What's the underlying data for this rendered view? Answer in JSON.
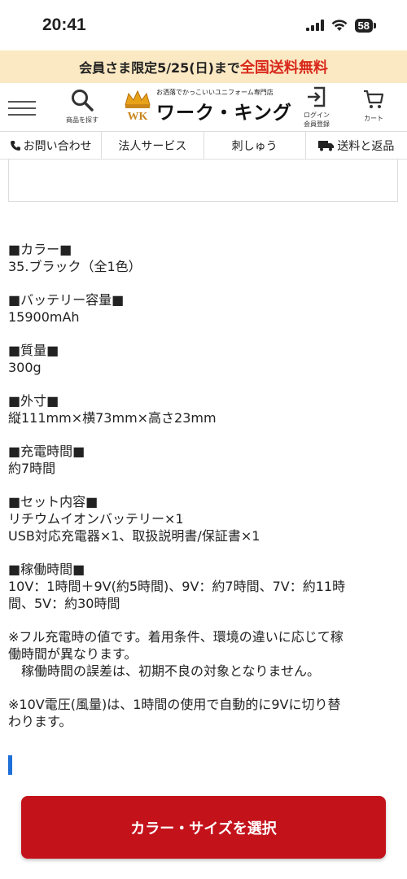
{
  "status_bar": {
    "time": "20:41",
    "battery": "58"
  },
  "promo": {
    "text": "会員さま限定5/25(日)まで",
    "highlight": "全国送料無料"
  },
  "header": {
    "search_label": "商品を探す",
    "logo_tagline": "お洒落でかっこいいユニフォーム専門店",
    "logo_name": "ワーク・キング",
    "logo_mark": "WK",
    "login_label_1": "ログイン",
    "login_label_2": "会員登録",
    "cart_label": "カート"
  },
  "nav": {
    "items": [
      {
        "label": "お問い合わせ",
        "icon": "phone-icon"
      },
      {
        "label": "法人サービス"
      },
      {
        "label": "刺しゅう"
      },
      {
        "label": "送料と返品",
        "icon": "truck-icon"
      }
    ]
  },
  "specs": [
    {
      "heading": "■カラー■",
      "value": "35.ブラック（全1色）"
    },
    {
      "heading": "■バッテリー容量■",
      "value": "15900mAh"
    },
    {
      "heading": "■質量■",
      "value": "300g"
    },
    {
      "heading": "■外寸■",
      "value": "縦111mm×横73mm×高さ23mm"
    },
    {
      "heading": "■充電時間■",
      "value": "約7時間"
    },
    {
      "heading": "■セット内容■",
      "value": "リチウムイオンバッテリー×1\nUSB対応充電器×1、取扱説明書/保証書×1"
    },
    {
      "heading": "■稼働時間■",
      "value": "10V：1時間＋9V(約5時間)、9V：約7時間、7V：約11時\n間、5V：約30時間"
    }
  ],
  "notes": [
    "※フル充電時の値です。着用条件、環境の違いに応じて稼\n働時間が異なります。\n　稼働時間の誤差は、初期不良の対象となりません。",
    "※10V電圧(風量)は、1時間の使用で自動的に9Vに切り替\nわります。"
  ],
  "cta": {
    "label": "カラー・サイズを選択"
  },
  "colors": {
    "promo_bg": "#fbe9c3",
    "accent_red": "#d9291c",
    "button_red": "#c4121b",
    "accent_blue": "#1e6fd8"
  }
}
